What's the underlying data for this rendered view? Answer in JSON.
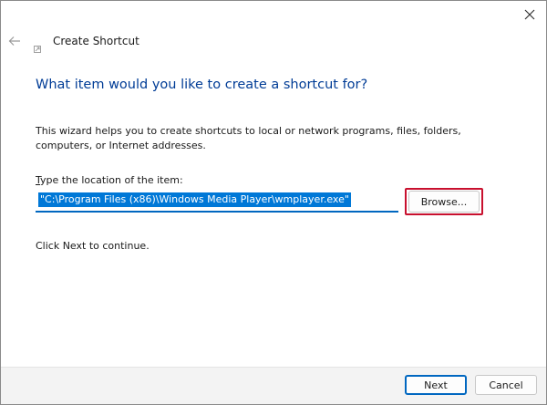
{
  "window": {
    "title": "Create Shortcut",
    "close_icon": "close-icon",
    "back_icon": "back-arrow-icon"
  },
  "main": {
    "heading": "What item would you like to create a shortcut for?",
    "description": "This wizard helps you to create shortcuts to local or network programs, files, folders, computers, or Internet addresses.",
    "location_label_first": "T",
    "location_label_rest": "ype the location of the item:",
    "location_value": "\"C:\\Program Files (x86)\\Windows Media Player\\wmplayer.exe\"",
    "browse_label": "Browse...",
    "continue_text": "Click Next to continue."
  },
  "footer": {
    "next_label": "Next",
    "cancel_label": "Cancel"
  },
  "colors": {
    "heading": "#003c96",
    "accent": "#0067c0",
    "selection": "#0078d7",
    "highlight_box": "#c8102e"
  }
}
